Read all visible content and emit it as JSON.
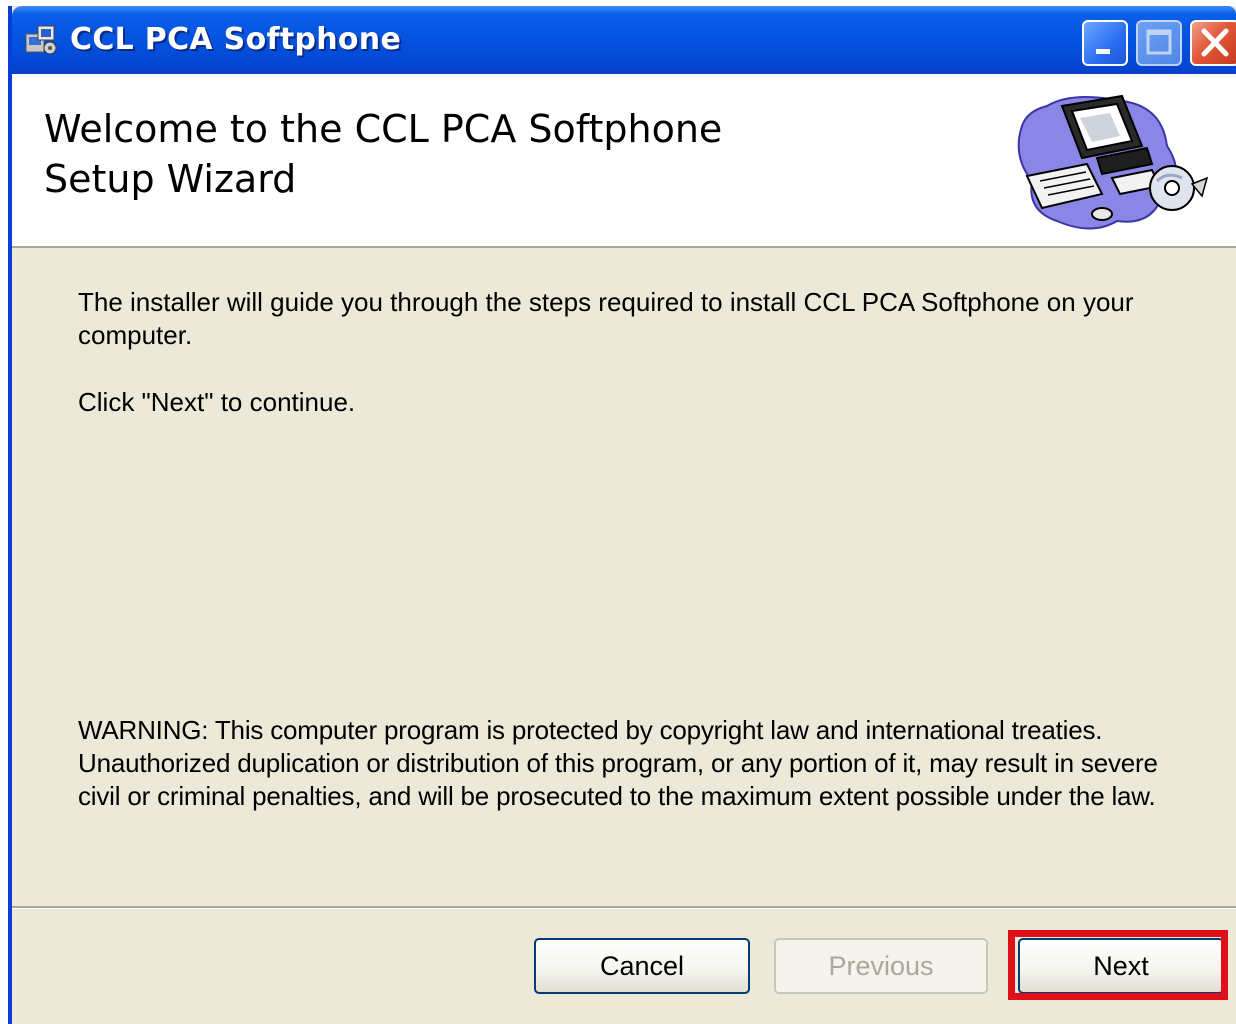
{
  "window": {
    "title": "CCL PCA Softphone",
    "icons": {
      "app": "installer-icon",
      "minimize": "minimize-icon",
      "maximize": "maximize-icon",
      "close": "close-icon"
    },
    "colors": {
      "titlebar": "#0453e0",
      "dialog_bg": "#ece9d8",
      "close_button": "#e2573a",
      "highlight": "#e0101a"
    }
  },
  "header": {
    "title_line1": "Welcome to the CCL PCA Softphone",
    "title_line2": "Setup Wizard",
    "art": "computer-cd-icon"
  },
  "body": {
    "intro": "The installer will guide you through the steps required to install CCL PCA Softphone on your computer.",
    "continue": "Click \"Next\" to continue.",
    "warning": "WARNING: This computer program is protected by copyright law and international treaties. Unauthorized duplication or distribution of this program, or any portion of it, may result in severe civil or criminal penalties, and will be prosecuted to the maximum extent possible under the law."
  },
  "buttons": {
    "cancel": "Cancel",
    "previous": "Previous",
    "next": "Next",
    "previous_enabled": false,
    "next_highlighted": true
  }
}
